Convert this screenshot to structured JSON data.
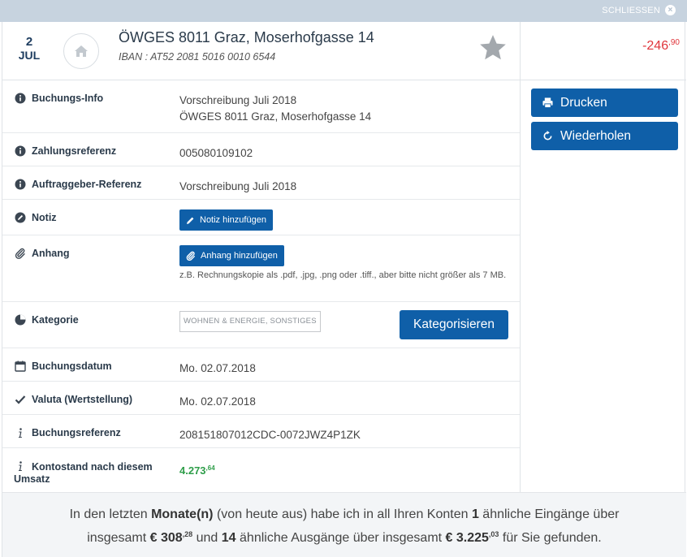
{
  "window": {
    "close_label": "SCHLIESSEN",
    "close_icon": "×"
  },
  "transaction": {
    "day": "2",
    "month": "JUL",
    "title": "ÖWGES 8011 Graz, Moserhofgasse 14",
    "iban": "IBAN : AT52 2081 5016 0010 6544",
    "amount_main": "-246",
    "amount_cents": ",90"
  },
  "rows": {
    "buchungs_info": {
      "label": "Buchungs-Info",
      "line1": "Vorschreibung Juli 2018",
      "line2": "ÖWGES 8011 Graz, Moserhofgasse 14"
    },
    "zahlungsreferenz": {
      "label": "Zahlungsreferenz",
      "value": "005080109102"
    },
    "auftraggeber": {
      "label": "Auftraggeber-Referenz",
      "value": "Vorschreibung Juli 2018"
    },
    "notiz": {
      "label": "Notiz",
      "button": "Notiz hinzufügen"
    },
    "anhang": {
      "label": "Anhang",
      "button": "Anhang hinzufügen",
      "hint": "z.B. Rechnungskopie als .pdf, .jpg, .png oder .tiff., aber bitte nicht größer als 7 MB."
    },
    "kategorie": {
      "label": "Kategorie",
      "tag": "WOHNEN & ENERGIE, SONSTIGES",
      "button": "Kategorisieren"
    },
    "buchungsdatum": {
      "label": "Buchungsdatum",
      "value": "Mo. 02.07.2018"
    },
    "valuta": {
      "label": "Valuta (Wertstellung)",
      "value": "Mo. 02.07.2018"
    },
    "buchungsreferenz": {
      "label": "Buchungsreferenz",
      "value": "208151807012CDC-0072JWZ4P1ZK"
    },
    "kontostand": {
      "label_line1": "Kontostand nach diesem",
      "label_line2": "Umsatz",
      "main": "4.273",
      "cents": ",64"
    }
  },
  "actions": {
    "print": "Drucken",
    "repeat": "Wiederholen"
  },
  "footer": {
    "p1": "In den letzten ",
    "b1": "Monate(n)",
    "p2": " (von heute aus) habe ich in all Ihren Konten ",
    "b2": "1",
    "p3": " ähnliche Eingänge über",
    "p4": "insgesamt ",
    "b3": "€ 308",
    "s1": ",28",
    "p5": " und ",
    "b4": "14",
    "p6": " ähnliche Ausgänge über insgesamt ",
    "b5": "€ 3.225",
    "s2": ",03",
    "p7": " für Sie gefunden."
  },
  "colors": {
    "accent": "#0f5fa8",
    "negative": "#e0353b",
    "positive": "#2f9e4a",
    "topbar": "#c7d3df"
  }
}
